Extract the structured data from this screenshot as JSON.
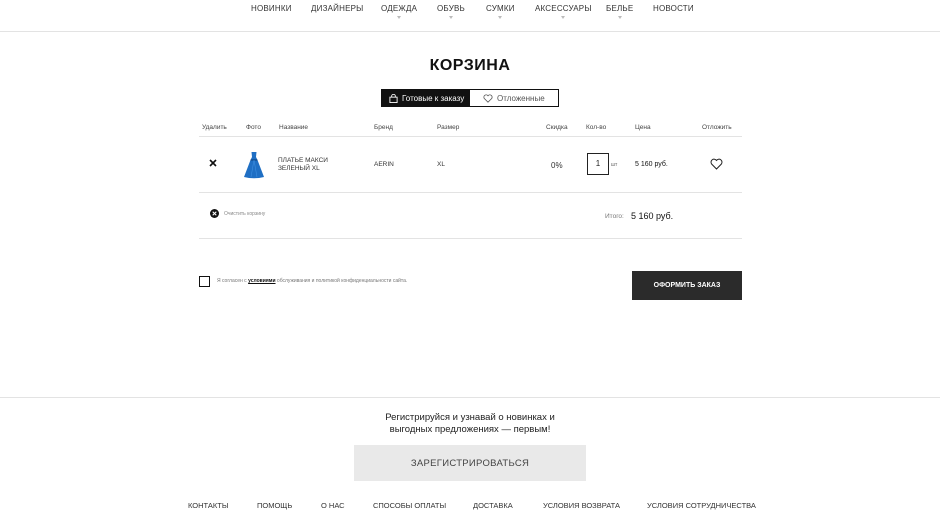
{
  "nav": {
    "items": [
      {
        "label": "НОВИНКИ",
        "has_caret": false
      },
      {
        "label": "ДИЗАЙНЕРЫ",
        "has_caret": false
      },
      {
        "label": "ОДЕЖДА",
        "has_caret": true
      },
      {
        "label": "ОБУВЬ",
        "has_caret": true
      },
      {
        "label": "СУМКИ",
        "has_caret": true
      },
      {
        "label": "АКСЕССУАРЫ",
        "has_caret": true
      },
      {
        "label": "БЕЛЬЕ",
        "has_caret": true
      },
      {
        "label": "НОВОСТИ",
        "has_caret": false
      }
    ]
  },
  "cart": {
    "title": "КОРЗИНА",
    "tabs": [
      {
        "label": "Готовые к заказу",
        "icon": "bag-icon",
        "active": true
      },
      {
        "label": "Отложенные",
        "icon": "heart-icon",
        "active": false
      }
    ],
    "columns": {
      "delete": "Удалить",
      "photo": "Фото",
      "name": "Название",
      "brand": "Бренд",
      "size": "Размер",
      "discount": "Скидка",
      "qty": "Кол-во",
      "price": "Цена",
      "postpone": "Отложить"
    },
    "items": [
      {
        "name": "ПЛАТЬЕ МАКСИ ЗЕЛЕНЫЙ XL",
        "brand": "AERIN",
        "size": "XL",
        "discount": "0%",
        "qty": "1",
        "qty_unit": "шт",
        "price": "5 160 руб.",
        "photo_icon": "dress-icon"
      }
    ],
    "clear_label": "Очистить корзину",
    "total_label": "Итого:",
    "total_value": "5 160 руб.",
    "agree": {
      "prefix": "Я согласен с",
      "link": "условиями",
      "suffix": "обслуживания и политикой конфиденциальности сайта."
    },
    "order_button": "ОФОРМИТЬ ЗАКАЗ"
  },
  "footer": {
    "promo_line1": "Регистрируйся и узнавай о новинках и",
    "promo_line2": "выгодных предложениях — первым!",
    "register_button": "ЗАРЕГИСТРИРОВАТЬСЯ",
    "links": [
      "КОНТАКТЫ",
      "ПОМОЩЬ",
      "О НАС",
      "СПОСОБЫ ОПЛАТЫ",
      "ДОСТАВКА",
      "УСЛОВИЯ ВОЗВРАТА",
      "УСЛОВИЯ СОТРУДНИЧЕСТВА"
    ]
  },
  "colors": {
    "dark": "#2b2b2b",
    "dress": "#1f6fc4",
    "divider": "#e3e3e3"
  }
}
